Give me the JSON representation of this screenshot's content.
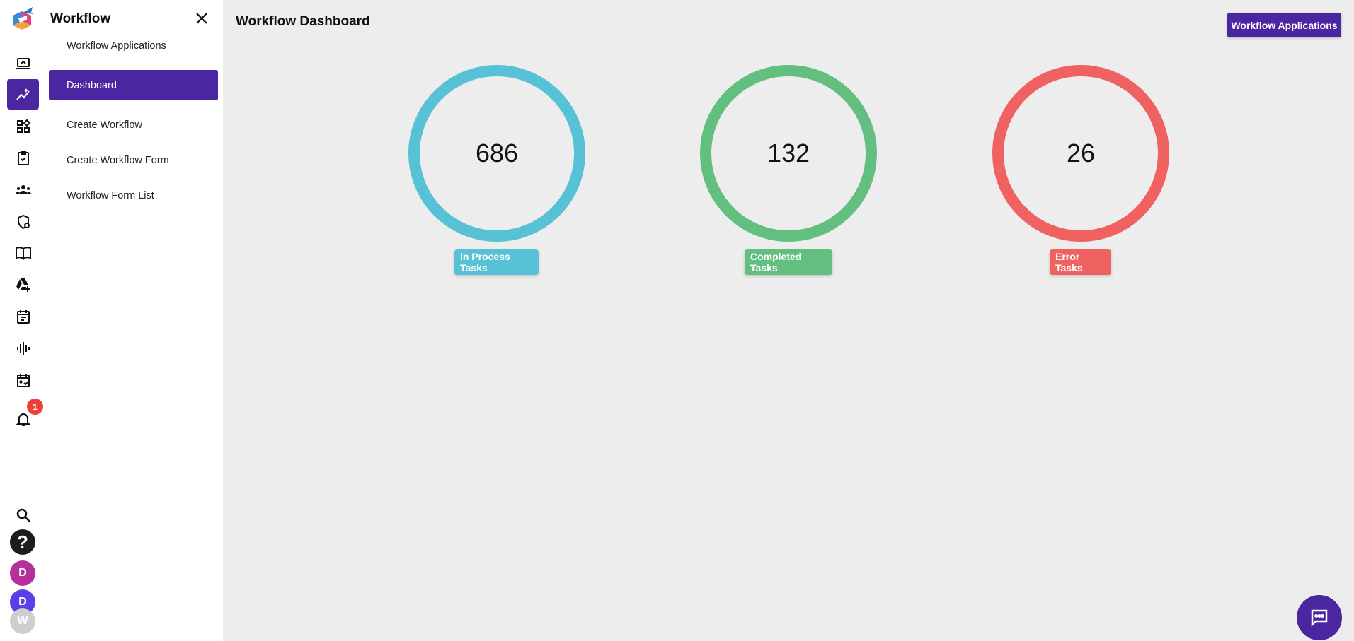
{
  "sidebar_title": "Workflow",
  "nav_items": [
    {
      "label": "Workflow Applications"
    },
    {
      "label": "Dashboard"
    },
    {
      "label": "Create Workflow"
    },
    {
      "label": "Create Workflow Form"
    },
    {
      "label": "Workflow Form List"
    }
  ],
  "page_title": "Workflow Dashboard",
  "top_button": "Workflow Applications",
  "notification_count": "1",
  "help_label": "?",
  "avatars": [
    {
      "initial": "D",
      "color": "#b5309c"
    },
    {
      "initial": "D",
      "color": "#5a3fe6"
    },
    {
      "initial": "W",
      "color": "#cfcfcf"
    }
  ],
  "stats": [
    {
      "value": "686",
      "label": "In Process Tasks",
      "color": "#57c2d6"
    },
    {
      "value": "132",
      "label": "Completed Tasks",
      "color": "#62bf80"
    },
    {
      "value": "26",
      "label": "Error Tasks",
      "color": "#f06262"
    }
  ],
  "colors": {
    "accent": "#4a27a0"
  }
}
